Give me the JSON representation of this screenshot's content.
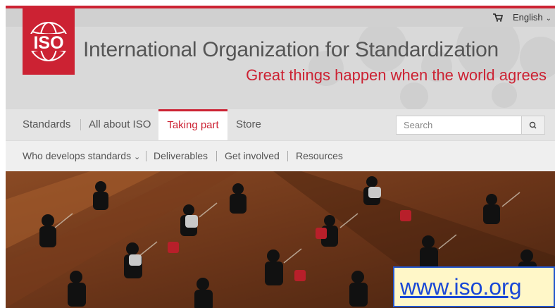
{
  "header": {
    "logo_text": "ISO",
    "org_name": "International Organization for Standardization",
    "tagline": "Great things happen when the world agrees",
    "language": "English"
  },
  "nav": {
    "items": [
      {
        "label": "Standards"
      },
      {
        "label": "All about ISO"
      },
      {
        "label": "Taking part"
      },
      {
        "label": "Store"
      }
    ],
    "active": "Taking part"
  },
  "search": {
    "placeholder": "Search"
  },
  "subnav": {
    "items": [
      {
        "label": "Who develops standards"
      },
      {
        "label": "Deliverables"
      },
      {
        "label": "Get involved"
      },
      {
        "label": "Resources"
      }
    ]
  },
  "hero": {
    "description": "orchestra-photo"
  },
  "url_overlay": {
    "text": "www.iso.org"
  },
  "colors": {
    "brand_red": "#cc2233",
    "link_blue": "#1a48d6",
    "overlay_bg": "#fff7c8"
  },
  "icons": [
    "cart-icon",
    "chevron-down-icon",
    "iso-globe-logo",
    "search-icon"
  ]
}
